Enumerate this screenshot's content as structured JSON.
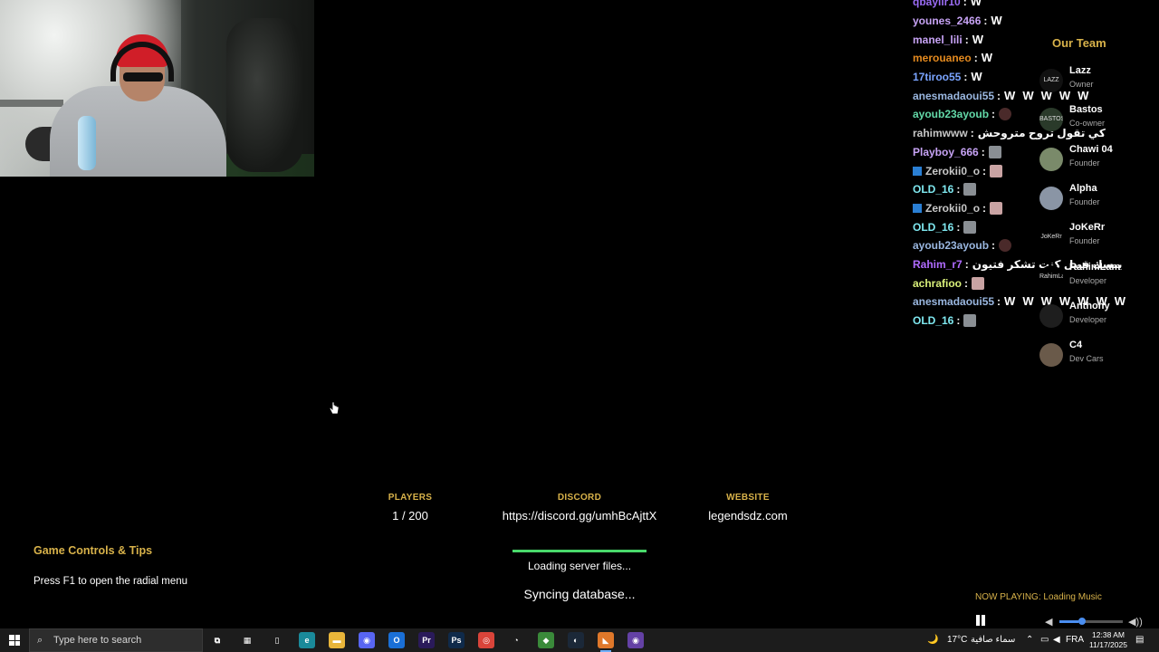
{
  "chat": {
    "messages": [
      {
        "name": "qbaylir10",
        "color": "#9b6cf5",
        "emotes": [
          "W"
        ],
        "text": ""
      },
      {
        "name": "younes_2466",
        "color": "#c7a3f5",
        "emotes": [
          "W"
        ],
        "text": ""
      },
      {
        "name": "manel_lili",
        "color": "#c7a3f5",
        "emotes": [
          "W"
        ],
        "text": ""
      },
      {
        "name": "merouaneo",
        "color": "#e48a1f",
        "emotes": [
          "W"
        ],
        "text": ""
      },
      {
        "name": "17tiroo55",
        "color": "#7aa4ff",
        "emotes": [
          "W"
        ],
        "text": ""
      },
      {
        "name": "anesmadaoui55",
        "color": "#9ab7e0",
        "emotes": [
          "W",
          "W",
          "W",
          "W",
          "W"
        ],
        "text": ""
      },
      {
        "name": "ayoub23ayoub",
        "color": "#63d9a8",
        "emotes": [
          "bear"
        ],
        "text": ""
      },
      {
        "name": "rahimwww",
        "color": "#c7c7c7",
        "emotes": [],
        "text": "كي تقول تروح متروحش"
      },
      {
        "name": "Playboy_666",
        "color": "#c7a3f5",
        "emotes": [
          "face"
        ],
        "text": ""
      },
      {
        "name": "Zerokii0_o",
        "color": "#c7c7c7",
        "badge": true,
        "emotes": [
          "pink"
        ],
        "text": ""
      },
      {
        "name": "OLD_16",
        "color": "#7fe8f0",
        "emotes": [
          "face"
        ],
        "text": ""
      },
      {
        "name": "Zerokii0_o",
        "color": "#c7c7c7",
        "badge": true,
        "emotes": [
          "pink"
        ],
        "text": ""
      },
      {
        "name": "OLD_16",
        "color": "#7fe8f0",
        "emotes": [
          "face"
        ],
        "text": ""
      },
      {
        "name": "ayoub23ayoub",
        "color": "#9ab7e0",
        "emotes": [
          "bear"
        ],
        "text": ""
      },
      {
        "name": "Rahim_r7",
        "color": "#b06bff",
        "emotes": [],
        "text": "يبسك قبيل كنت تشكر فتيون",
        "trailing": [
          "red",
          "red"
        ]
      },
      {
        "name": "achrafioo",
        "color": "#d9f07a",
        "emotes": [
          "pink"
        ],
        "text": ""
      },
      {
        "name": "anesmadaoui55",
        "color": "#9ab7e0",
        "emotes": [
          "W",
          "W",
          "W",
          "W",
          "W",
          "W",
          "W"
        ],
        "text": ""
      },
      {
        "name": "OLD_16",
        "color": "#7fe8f0",
        "emotes": [
          "face"
        ],
        "text": ""
      }
    ]
  },
  "team": {
    "title": "Our Team",
    "members": [
      {
        "name": "Lazz",
        "role": "Owner",
        "avatar_text": "LAZZ",
        "avatar_color": "#111111"
      },
      {
        "name": "Bastos",
        "role": "Co-owner",
        "avatar_text": "BASTOS",
        "avatar_color": "#2a3a2a"
      },
      {
        "name": "Chawi 04",
        "role": "Founder",
        "avatar_text": "",
        "avatar_color": "#7a8a6a"
      },
      {
        "name": "Alpha",
        "role": "Founder",
        "avatar_text": "",
        "avatar_color": "#8a95a5"
      },
      {
        "name": "JoKeRr",
        "role": "Founder",
        "avatar_text": "JoKeRr",
        "avatar_color": "#000000"
      },
      {
        "name": "RahimLam",
        "role": "Developer",
        "avatar_text": "RahimLam",
        "avatar_color": "#000000"
      },
      {
        "name": "Anthony",
        "role": "Developer",
        "avatar_text": "",
        "avatar_color": "#1e1e1e"
      },
      {
        "name": "C4",
        "role": "Dev Cars",
        "avatar_text": "",
        "avatar_color": "#6a5a4a"
      }
    ]
  },
  "server_info": {
    "players_label": "PLAYERS",
    "players_value": "1 / 200",
    "discord_label": "DISCORD",
    "discord_value": "https://discord.gg/umhBcAjttX",
    "website_label": "WEBSITE",
    "website_value": "legendsdz.com"
  },
  "loading": {
    "progress": 1.0,
    "status": "Loading server files...",
    "sub_status": "Syncing database..."
  },
  "tips": {
    "title": "Game Controls & Tips",
    "text": "Press F1 to open the radial menu"
  },
  "music": {
    "now_playing": "NOW PLAYING: Loading Music",
    "volume": 0.3
  },
  "taskbar": {
    "search_placeholder": "Type here to search",
    "weather": "17°C",
    "weather_text": "سماء صافية",
    "language": "FRA",
    "time": "12:38 AM",
    "date": "11/17/2025",
    "apps": [
      {
        "name": "task-view-icon",
        "glyph": "⧉",
        "color": "#1c1c1c"
      },
      {
        "name": "store-icon",
        "glyph": "▦",
        "color": "#1c1c1c"
      },
      {
        "name": "file-icon",
        "glyph": "▯",
        "color": "#1c1c1c"
      },
      {
        "name": "edge-icon",
        "glyph": "e",
        "color": "#1a8a9a"
      },
      {
        "name": "explorer-icon",
        "glyph": "▬",
        "color": "#e8b53a"
      },
      {
        "name": "discord-icon",
        "glyph": "◉",
        "color": "#5865f2"
      },
      {
        "name": "outlook-icon",
        "glyph": "O",
        "color": "#1a6fd6"
      },
      {
        "name": "premiere-icon",
        "glyph": "Pr",
        "color": "#2a1a5a"
      },
      {
        "name": "photoshop-icon",
        "glyph": "Ps",
        "color": "#0f2a4a"
      },
      {
        "name": "chrome-icon",
        "glyph": "◎",
        "color": "#d9443a"
      },
      {
        "name": "speedtest-icon",
        "glyph": "◔",
        "color": "#1c1c1c"
      },
      {
        "name": "shield-icon",
        "glyph": "◆",
        "color": "#3a8a3a"
      },
      {
        "name": "steam-icon",
        "glyph": "◐",
        "color": "#1b2838"
      },
      {
        "name": "fivem-icon",
        "glyph": "◣",
        "color": "#e0782a"
      },
      {
        "name": "twitch-icon",
        "glyph": "◉",
        "color": "#6441a5"
      }
    ]
  }
}
